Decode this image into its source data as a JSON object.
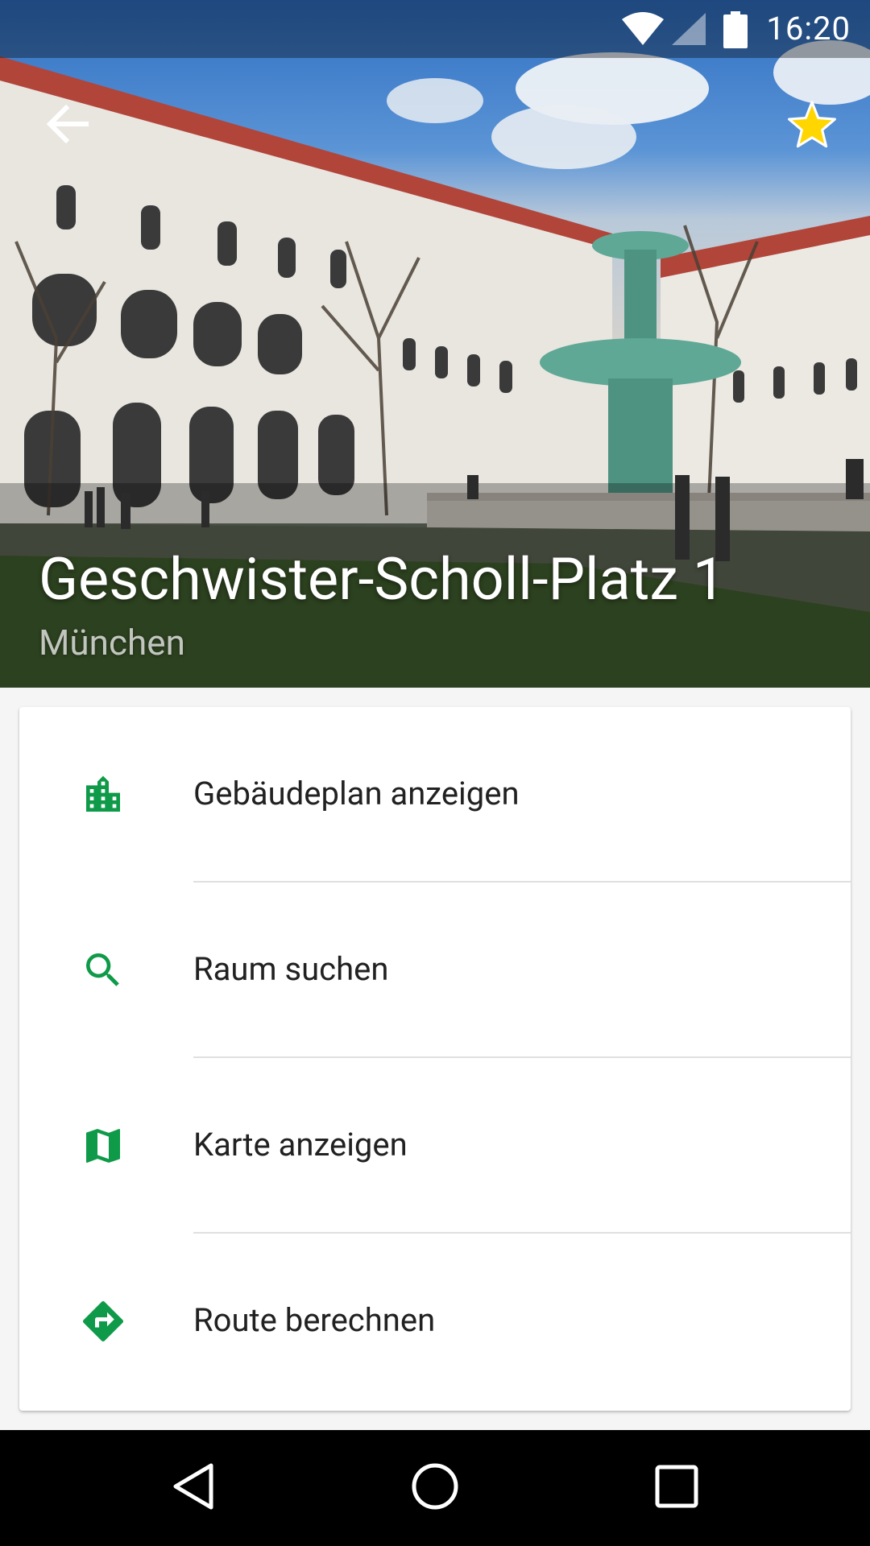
{
  "status_bar": {
    "time": "16:20",
    "icons": [
      "wifi-icon",
      "signal-icon",
      "battery-icon"
    ]
  },
  "toolbar": {
    "back_icon": "arrow-back-icon",
    "favorite_icon": "star-icon",
    "favorite_color": "#FFD600"
  },
  "header": {
    "title": "Geschwister-Scholl-Platz 1",
    "subtitle": "München"
  },
  "actions": [
    {
      "label": "Gebäudeplan anzeigen",
      "icon": "building-icon"
    },
    {
      "label": "Raum suchen",
      "icon": "search-icon"
    },
    {
      "label": "Karte anzeigen",
      "icon": "map-icon"
    },
    {
      "label": "Route berechnen",
      "icon": "directions-icon"
    }
  ],
  "colors": {
    "accent": "#0E9A48",
    "text": "#212121"
  },
  "nav_bar": {
    "icons": [
      "back-nav-icon",
      "home-nav-icon",
      "recents-nav-icon"
    ]
  }
}
